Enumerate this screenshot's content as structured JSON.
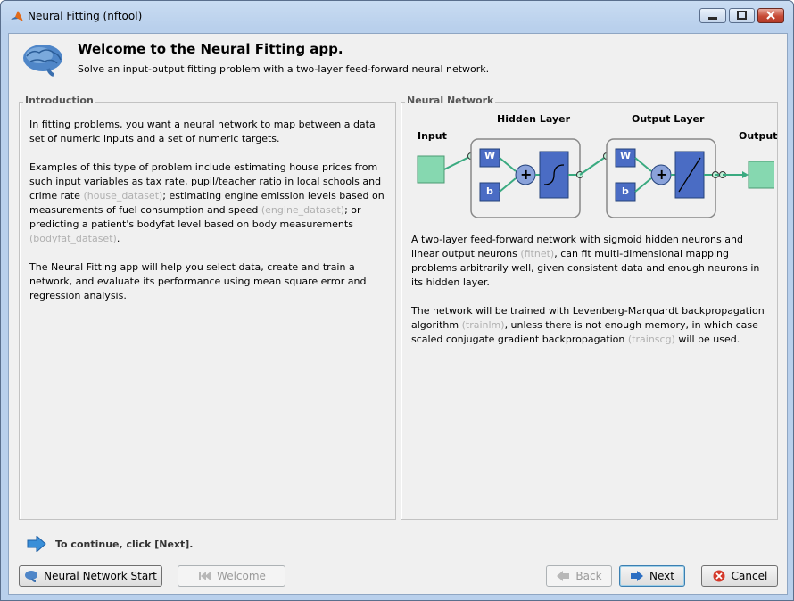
{
  "window": {
    "title": "Neural Fitting (nftool)",
    "controls": {
      "minimize": "minimize-icon",
      "maximize": "maximize-icon",
      "close": "close-icon"
    }
  },
  "header": {
    "title": "Welcome to the Neural Fitting app.",
    "subtitle": "Solve an input-output fitting problem with a two-layer feed-forward neural network."
  },
  "intro": {
    "legend": "Introduction",
    "p1": "In fitting problems, you want a neural network to map between a data set of numeric inputs and a set of numeric targets.",
    "p2_a": "Examples of this type of problem include estimating house prices from such input variables as tax rate, pupil/teacher ratio in local schools and crime rate ",
    "p2_ref1": "(house_dataset)",
    "p2_b": "; estimating engine emission levels based on measurements of fuel consumption and speed ",
    "p2_ref2": "(engine_dataset)",
    "p2_c": "; or predicting a patient's bodyfat level based on body measurements ",
    "p2_ref3": "(bodyfat_dataset)",
    "p2_d": ".",
    "p3": "The Neural Fitting app will help you select data, create and train a network, and evaluate its performance using mean square error and regression analysis."
  },
  "network": {
    "legend": "Neural Network",
    "diagram": {
      "input_label": "Input",
      "hidden_label": "Hidden Layer",
      "output_layer_label": "Output Layer",
      "output_label": "Output",
      "weight": "W",
      "bias": "b",
      "sum": "+"
    },
    "p1_a": "A two-layer feed-forward network with sigmoid hidden neurons and linear output neurons ",
    "p1_ref": "(fitnet)",
    "p1_b": ", can fit multi-dimensional mapping problems arbitrarily well, given consistent data and enough neurons in its hidden layer.",
    "p2_a": "The network will be trained with Levenberg-Marquardt backpropagation algorithm ",
    "p2_ref1": "(trainlm)",
    "p2_b": ", unless there is not enough memory, in which case scaled conjugate gradient backpropagation ",
    "p2_ref2": "(trainscg)",
    "p2_c": " will be used."
  },
  "hint": "To continue, click [Next].",
  "buttons": {
    "start": "Neural Network Start",
    "welcome": "Welcome",
    "back": "Back",
    "next": "Next",
    "cancel": "Cancel"
  },
  "colors": {
    "green_io": "#86d8b0",
    "blue_block": "#4a6cc4",
    "accent": "#3a8fd8"
  }
}
